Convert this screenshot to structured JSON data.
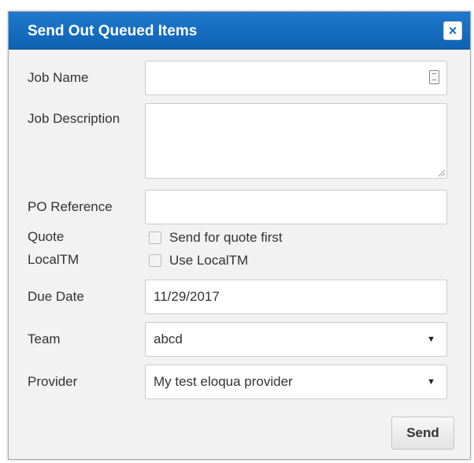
{
  "dialog": {
    "title": "Send Out Queued Items",
    "close_symbol": "×"
  },
  "form": {
    "job_name": {
      "label": "Job Name",
      "value": "",
      "icon": "keyboard-icon"
    },
    "job_description": {
      "label": "Job Description",
      "value": ""
    },
    "po_reference": {
      "label": "PO Reference",
      "value": ""
    },
    "quote": {
      "label": "Quote",
      "option_label": "Send for quote first",
      "checked": false
    },
    "localtm": {
      "label": "LocalTM",
      "option_label": "Use LocalTM",
      "checked": false
    },
    "due_date": {
      "label": "Due Date",
      "value": "11/29/2017"
    },
    "team": {
      "label": "Team",
      "selected": "abcd",
      "arrow": "▼"
    },
    "provider": {
      "label": "Provider",
      "selected": "My test eloqua provider",
      "arrow": "▼"
    }
  },
  "actions": {
    "send_label": "Send"
  },
  "colors": {
    "titlebar": "#1a6fc4",
    "panel": "#f2f2f2",
    "border": "#cccccc"
  }
}
